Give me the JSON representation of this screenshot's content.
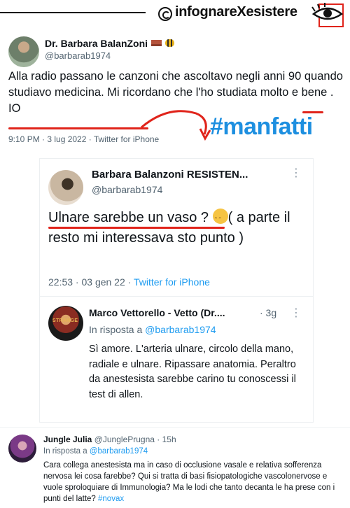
{
  "watermark": {
    "brand": "infognareXesistere",
    "logo_icon": "circle-c-icon",
    "eye_icon": "eye-icon"
  },
  "tweet_main": {
    "author_name": "Dr. Barbara BalanZoni",
    "author_emojis": [
      "brick-emoji",
      "bee-emoji"
    ],
    "handle": "@barbarab1974",
    "text_a": "Alla radio passano le canzoni che ascoltavo negli anni 90 quando studiavo medicina. Mi ricordano che ",
    "text_highlight": "l'ho studiata molto e bene",
    "text_b": " . IO",
    "meta": "9:10 PM · 3 lug 2022 · Twitter for iPhone",
    "overlay_hashtag": "#manfatti"
  },
  "quoted": {
    "author_name": "Barbara Balanzoni RESISTEN...",
    "handle": "@barbarab1974",
    "more_icon": "vertical-dots-icon",
    "text_highlight": "Ulnare sarebbe un vaso",
    "text_rest": " ? ",
    "emoji": "confounded-face-emoji",
    "text_tail": "( a parte  il resto mi interessava sto punto )",
    "meta_time": "22:53 · 03 gen 22 · ",
    "meta_source": "Twitter for iPhone",
    "reply": {
      "author_name": "Marco Vettorello - Vetto (Dr....",
      "time": "· 3g",
      "reply_prefix": "In risposta a ",
      "reply_to": "@barbarab1974",
      "avatar_label": "STRANGE",
      "text": "Sì amore. L'arteria ulnare, circolo della mano, radiale e ulnare. Ripassare anatomia. Peraltro da anestesista sarebbe carino tu conoscessi il test di allen."
    }
  },
  "tweet_bottom": {
    "author_name": "Jungle Julia",
    "handle_time": " @JunglePrugna · 15h",
    "reply_prefix": "In risposta a ",
    "reply_to": "@barbarab1974",
    "text": "Cara collega anestesista ma in caso di occlusione vasale e relativa sofferenza nervosa lei cosa farebbe? Qui si tratta di basi fisiopatologiche vascolonervose e vuole sproloquiare di Immunologia? Ma le lodi che tanto decanta le ha prese con i punti del latte? ",
    "hashtag": "#novax"
  },
  "colors": {
    "annotation_red": "#e0241b",
    "link_blue": "#1d9bf0",
    "hashtag_overlay": "#1d8fe0"
  }
}
